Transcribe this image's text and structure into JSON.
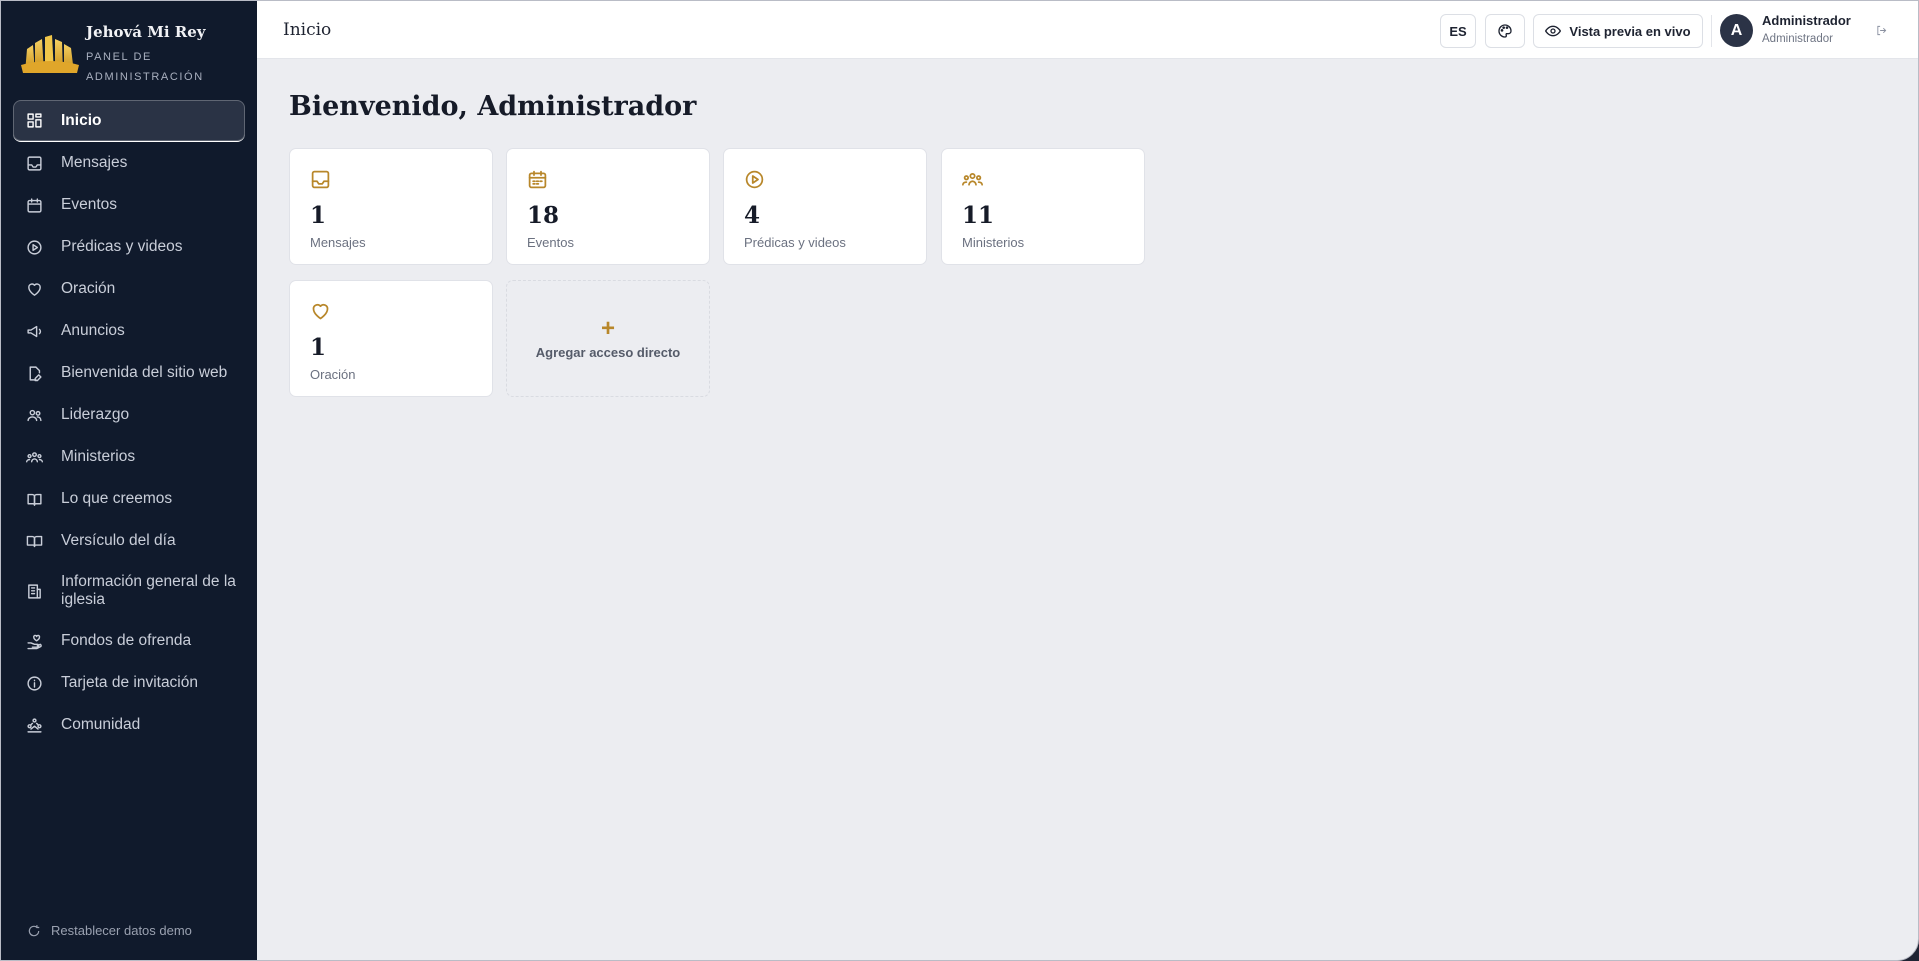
{
  "brand": {
    "title": "Jehová Mi Rey",
    "subtitle": "PANEL DE ADMINISTRACIÓN"
  },
  "sidebar": {
    "items": [
      {
        "label": "Inicio",
        "icon": "grid-icon"
      },
      {
        "label": "Mensajes",
        "icon": "inbox-icon"
      },
      {
        "label": "Eventos",
        "icon": "calendar-icon"
      },
      {
        "label": "Prédicas y videos",
        "icon": "play-circle-icon"
      },
      {
        "label": "Oración",
        "icon": "heart-icon"
      },
      {
        "label": "Anuncios",
        "icon": "megaphone-icon"
      },
      {
        "label": "Bienvenida del sitio web",
        "icon": "file-edit-icon"
      },
      {
        "label": "Liderazgo",
        "icon": "users-icon"
      },
      {
        "label": "Ministerios",
        "icon": "group-icon"
      },
      {
        "label": "Lo que creemos",
        "icon": "book-open-icon"
      },
      {
        "label": "Versículo del día",
        "icon": "book-icon"
      },
      {
        "label": "Información general de la iglesia",
        "icon": "building-icon"
      },
      {
        "label": "Fondos de ofrenda",
        "icon": "hand-heart-icon"
      },
      {
        "label": "Tarjeta de invitación",
        "icon": "info-icon"
      },
      {
        "label": "Comunidad",
        "icon": "community-icon"
      }
    ],
    "reset_label": "Restablecer datos demo"
  },
  "topbar": {
    "title": "Inicio",
    "lang": "ES",
    "preview_label": "Vista previa en vivo",
    "avatar_initial": "A",
    "user_name": "Administrador",
    "user_role": "Administrador"
  },
  "main": {
    "welcome": "Bienvenido, Administrador",
    "cards": [
      {
        "count": "1",
        "label": "Mensajes",
        "icon": "inbox-icon"
      },
      {
        "count": "18",
        "label": "Eventos",
        "icon": "calendar-icon"
      },
      {
        "count": "4",
        "label": "Prédicas y videos",
        "icon": "play-circle-icon"
      },
      {
        "count": "11",
        "label": "Ministerios",
        "icon": "group-icon"
      },
      {
        "count": "1",
        "label": "Oración",
        "icon": "heart-icon"
      }
    ],
    "add_shortcut": {
      "plus": "+",
      "label": "Agregar acceso directo"
    }
  },
  "colors": {
    "sidebar_bg": "#101a2c",
    "accent": "#b8872a",
    "page_bg": "#ecedf1"
  }
}
